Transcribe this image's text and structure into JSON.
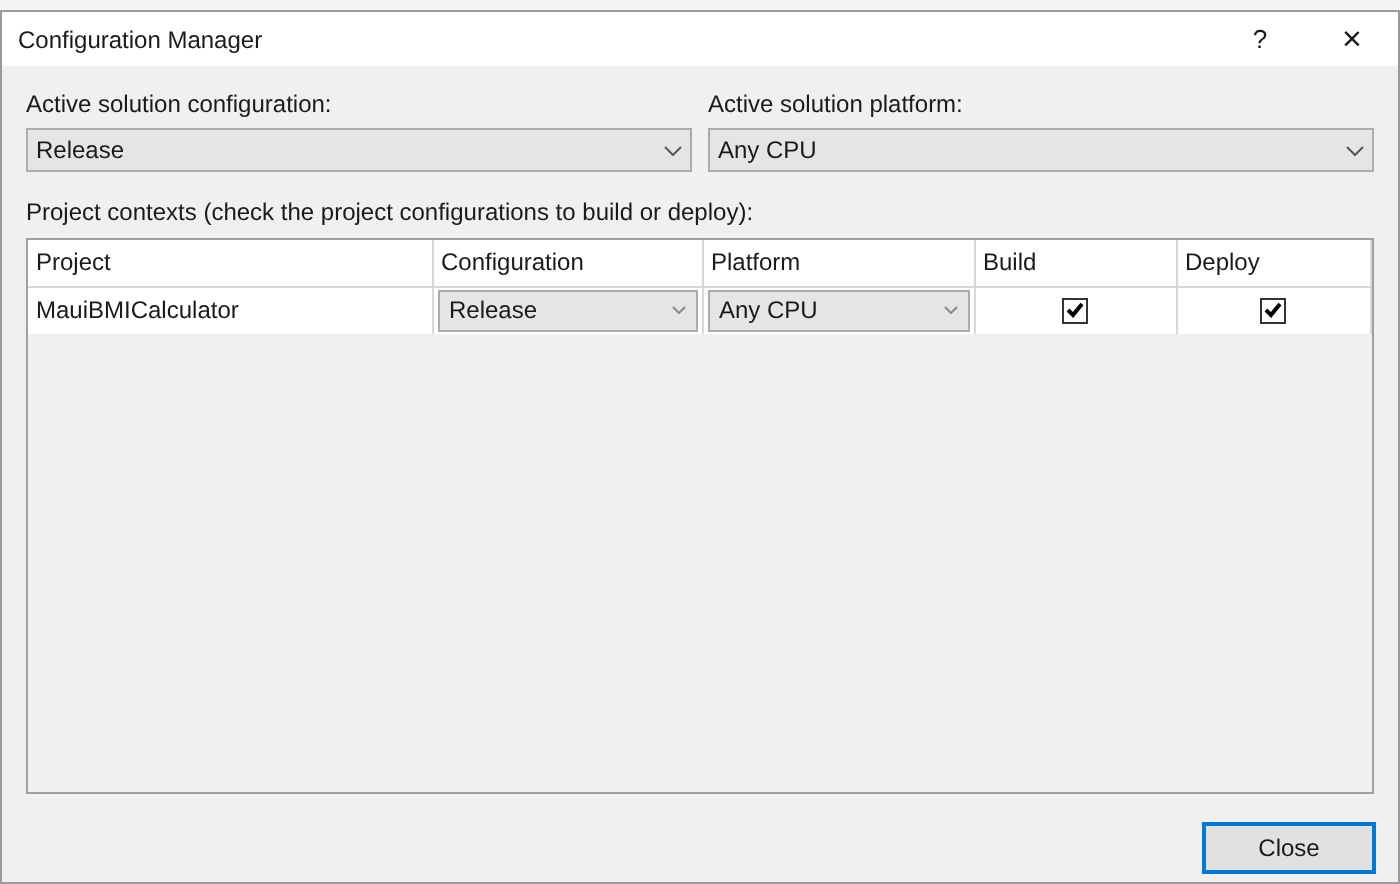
{
  "window": {
    "title": "Configuration Manager",
    "help": "?",
    "close": "×"
  },
  "solution_configuration": {
    "label": "Active solution configuration:",
    "value": "Release"
  },
  "solution_platform": {
    "label": "Active solution platform:",
    "value": "Any CPU"
  },
  "contexts_label": "Project contexts (check the project configurations to build or deploy):",
  "table": {
    "columns": [
      "Project",
      "Configuration",
      "Platform",
      "Build",
      "Deploy"
    ],
    "rows": [
      {
        "project": "MauiBMICalculator",
        "configuration": "Release",
        "platform": "Any CPU",
        "build": true,
        "deploy": true
      }
    ]
  },
  "buttons": [
    "Close"
  ]
}
